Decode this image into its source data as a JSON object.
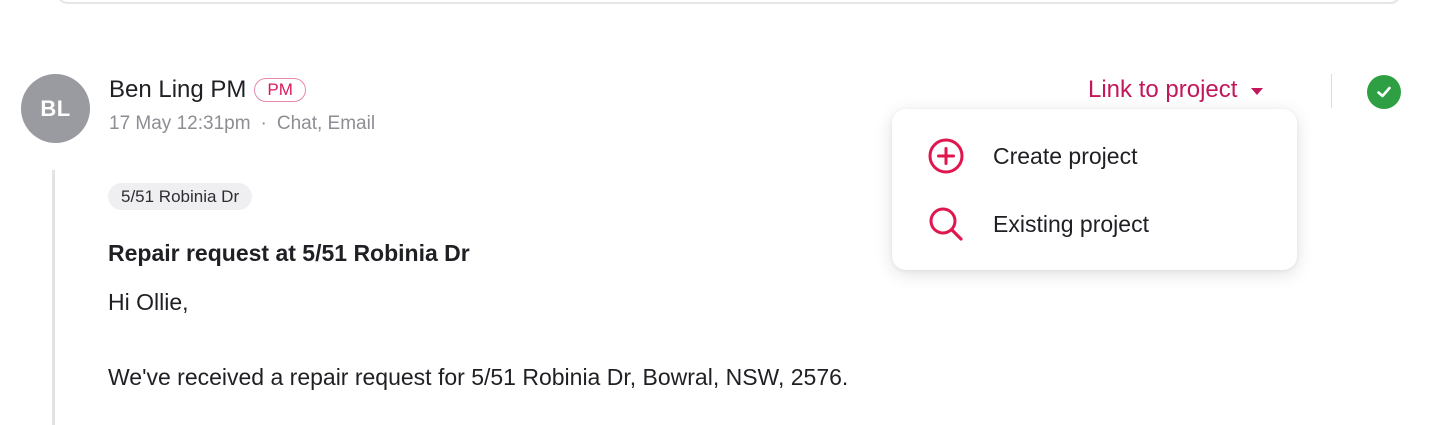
{
  "message": {
    "avatar_initials": "BL",
    "sender_name": "Ben Ling PM",
    "role_badge": "PM",
    "timestamp": "17 May 12:31pm",
    "meta_separator": "·",
    "channels": "Chat, Email",
    "address_tag": "5/51 Robinia Dr",
    "subject": "Repair request at 5/51 Robinia Dr",
    "greeting": "Hi Ollie,",
    "body": "We've received a repair request for 5/51 Robinia Dr, Bowral, NSW, 2576."
  },
  "actions": {
    "link_label": "Link to project",
    "status_icon": "check-circle-icon",
    "status_color": "#2ea043"
  },
  "dropdown": {
    "items": [
      {
        "label": "Create project",
        "icon": "plus-circle-icon"
      },
      {
        "label": "Existing project",
        "icon": "search-icon"
      }
    ]
  },
  "colors": {
    "accent": "#c2185b",
    "icon_accent": "#e0174f",
    "avatar_bg": "#9a9aa1",
    "muted_text": "#8d8d94"
  }
}
